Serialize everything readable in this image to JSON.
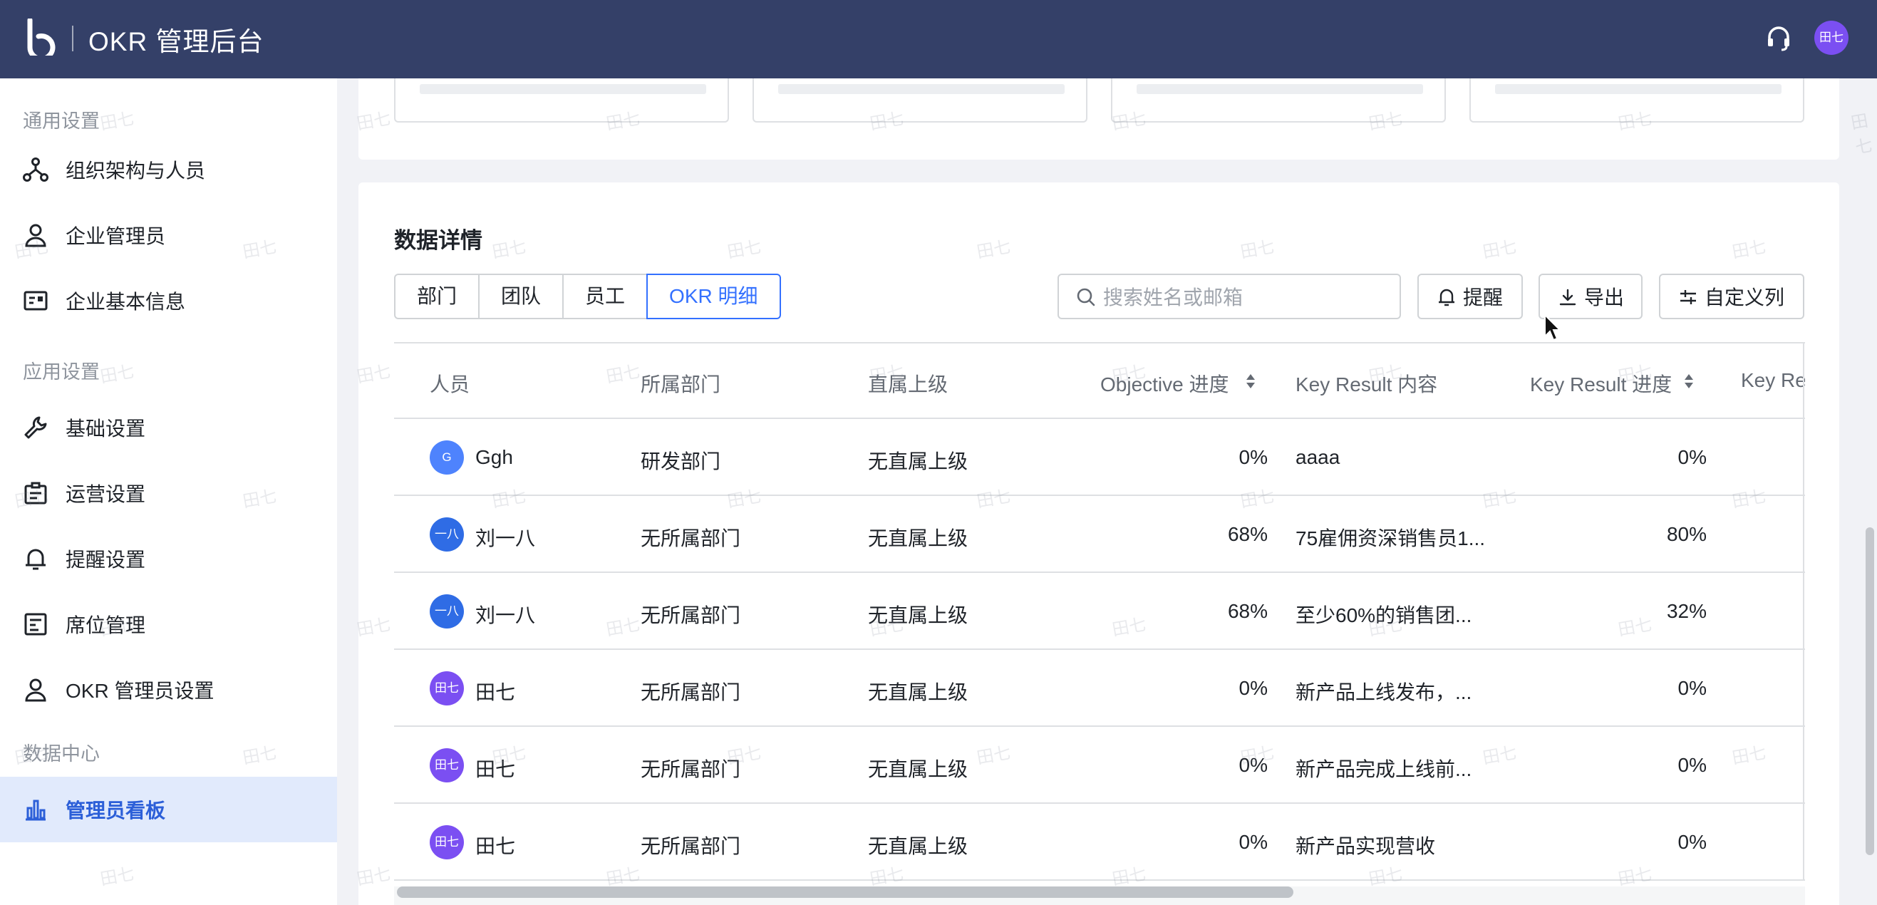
{
  "header": {
    "title": "OKR 管理后台",
    "avatar_text": "田七",
    "bg_color": "#344068"
  },
  "sidebar": {
    "sections": [
      "通用设置",
      "应用设置",
      "数据中心"
    ],
    "items": [
      {
        "label": "组织架构与人员",
        "icon": "org-chart-icon"
      },
      {
        "label": "企业管理员",
        "icon": "user-icon"
      },
      {
        "label": "企业基本信息",
        "icon": "id-card-icon"
      },
      {
        "label": "基础设置",
        "icon": "wrench-icon"
      },
      {
        "label": "运营设置",
        "icon": "clipboard-icon"
      },
      {
        "label": "提醒设置",
        "icon": "bell-icon"
      },
      {
        "label": "席位管理",
        "icon": "seat-icon"
      },
      {
        "label": "OKR 管理员设置",
        "icon": "user-icon"
      },
      {
        "label": "管理员看板",
        "icon": "bar-chart-icon",
        "active": true
      }
    ]
  },
  "detail": {
    "title": "数据详情",
    "tabs": [
      "部门",
      "团队",
      "员工",
      "OKR 明细"
    ],
    "active_tab": "OKR 明细",
    "search_placeholder": "搜索姓名或邮箱",
    "buttons": {
      "remind": "提醒",
      "export": "导出",
      "custom_columns": "自定义列"
    }
  },
  "table": {
    "columns": [
      "人员",
      "所属部门",
      "直属上级",
      "Objective 进度",
      "Key Result 内容",
      "Key Result 进度",
      "Key Re"
    ],
    "rows": [
      {
        "avatar": "G",
        "avatar_color": "#4e83fd",
        "name": "Ggh",
        "dept": "研发部门",
        "manager": "无直属上级",
        "obj_progress": "0%",
        "kr_content": "aaaa",
        "kr_progress": "0%"
      },
      {
        "avatar": "一八",
        "avatar_color": "#2f6ce5",
        "name": "刘一八",
        "dept": "无所属部门",
        "manager": "无直属上级",
        "obj_progress": "68%",
        "kr_content": "75雇佣资深销售员1...",
        "kr_progress": "80%"
      },
      {
        "avatar": "一八",
        "avatar_color": "#2f6ce5",
        "name": "刘一八",
        "dept": "无所属部门",
        "manager": "无直属上级",
        "obj_progress": "68%",
        "kr_content": "至少60%的销售团...",
        "kr_progress": "32%"
      },
      {
        "avatar": "田七",
        "avatar_color": "#7b4ff2",
        "name": "田七",
        "dept": "无所属部门",
        "manager": "无直属上级",
        "obj_progress": "0%",
        "kr_content": "新产品上线发布，...",
        "kr_progress": "0%"
      },
      {
        "avatar": "田七",
        "avatar_color": "#7b4ff2",
        "name": "田七",
        "dept": "无所属部门",
        "manager": "无直属上级",
        "obj_progress": "0%",
        "kr_content": "新产品完成上线前...",
        "kr_progress": "0%"
      },
      {
        "avatar": "田七",
        "avatar_color": "#7b4ff2",
        "name": "田七",
        "dept": "无所属部门",
        "manager": "无直属上级",
        "obj_progress": "0%",
        "kr_content": "新产品实现营收",
        "kr_progress": "0%"
      }
    ]
  },
  "watermark": "田七",
  "accent_color": "#3370ff"
}
